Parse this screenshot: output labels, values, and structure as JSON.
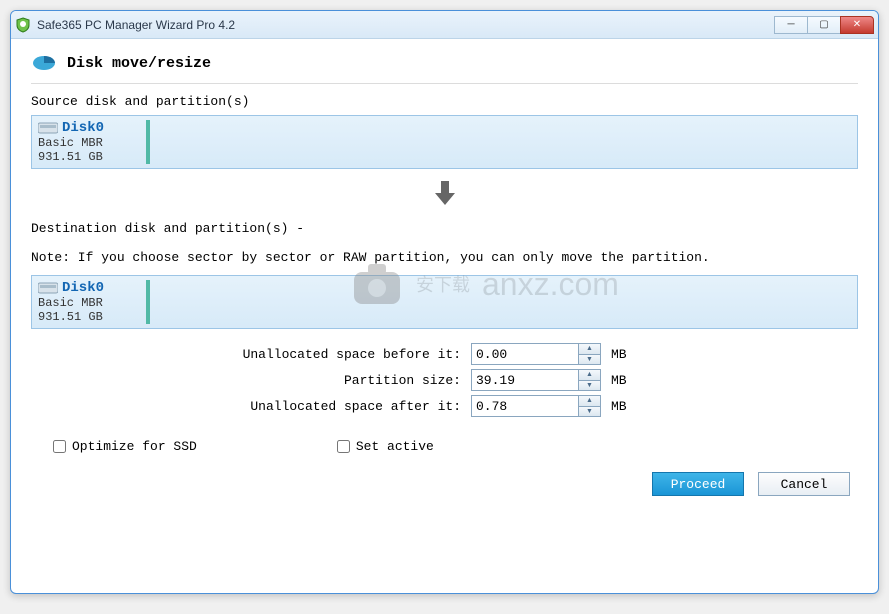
{
  "window": {
    "title": "Safe365 PC Manager Wizard Pro 4.2"
  },
  "header": {
    "title": "Disk move/resize"
  },
  "source": {
    "label": "Source disk and partition(s)",
    "disk": {
      "name": "Disk0",
      "type": "Basic MBR",
      "size": "931.51 GB"
    }
  },
  "destination": {
    "label": "Destination disk and partition(s) -",
    "note": "Note: If you choose sector by sector or RAW partition, you can only move the partition.",
    "disk": {
      "name": "Disk0",
      "type": "Basic MBR",
      "size": "931.51 GB"
    }
  },
  "fields": {
    "before": {
      "label": "Unallocated space before it:",
      "value": "0.00",
      "unit": "MB"
    },
    "size": {
      "label": "Partition size:",
      "value": "39.19",
      "unit": "MB"
    },
    "after": {
      "label": "Unallocated space after it:",
      "value": "0.78",
      "unit": "MB"
    }
  },
  "options": {
    "optimize_ssd": "Optimize for SSD",
    "set_active": "Set active"
  },
  "footer": {
    "proceed": "Proceed",
    "cancel": "Cancel"
  },
  "watermark": "anxz.com"
}
